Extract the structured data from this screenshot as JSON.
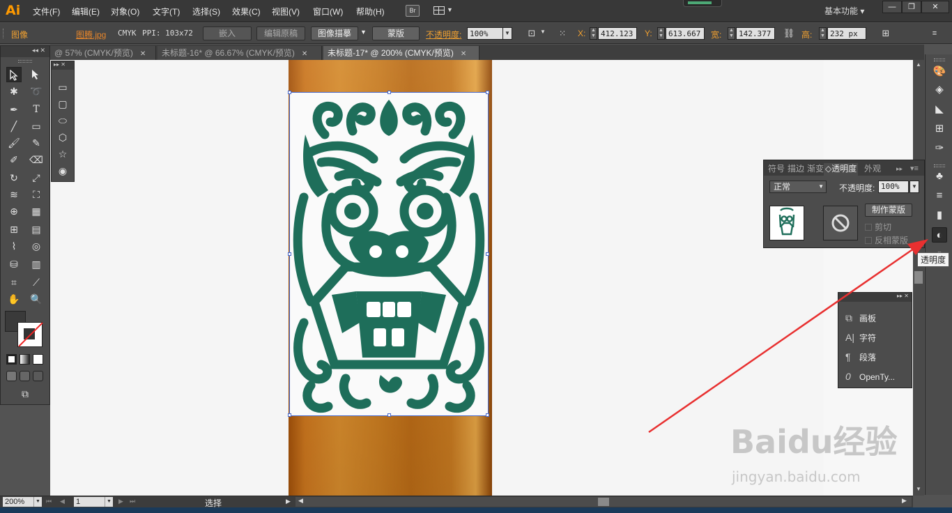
{
  "app": {
    "logo": "Ai",
    "menu": [
      "文件(F)",
      "编辑(E)",
      "对象(O)",
      "文字(T)",
      "选择(S)",
      "效果(C)",
      "视图(V)",
      "窗口(W)",
      "帮助(H)"
    ],
    "bridge_label": "Br",
    "workspace": "基本功能",
    "window_buttons": [
      "—",
      "❐",
      "✕"
    ]
  },
  "control": {
    "object_type": "图像",
    "file_name": "图腾.jpg",
    "color_mode": "CMYK",
    "ppi": "PPI: 103x72",
    "embed_btn": "嵌入",
    "edit_original_btn": "编辑原稿",
    "image_trace_btn": "图像描摹",
    "mask_btn": "蒙版",
    "opacity_label": "不透明度:",
    "opacity_value": "100%",
    "x_label": "X:",
    "x_value": "412.123",
    "y_label": "Y:",
    "y_value": "613.667",
    "w_label": "宽:",
    "w_value": "142.377",
    "h_label": "高:",
    "h_value": "232 px"
  },
  "tabs": [
    {
      "label": "@ 57% (CMYK/预览)"
    },
    {
      "label": "未标题-16* @ 66.67% (CMYK/预览)"
    },
    {
      "label": "未标题-17* @ 200% (CMYK/预览)"
    }
  ],
  "transparency": {
    "tabs": [
      "符号",
      "描边",
      "渐变",
      "透明度",
      "外观"
    ],
    "active_tab": "透明度",
    "blend_mode": "正常",
    "opacity_label": "不透明度:",
    "opacity_value": "100%",
    "make_mask_btn": "制作蒙版",
    "clip_label": "剪切",
    "invert_label": "反相蒙版"
  },
  "tooltip": "透明度",
  "float_panel": {
    "items": [
      {
        "label": "画板",
        "icon": "artboard-icon"
      },
      {
        "label": "字符",
        "icon": "character-icon"
      },
      {
        "label": "段落",
        "icon": "paragraph-icon"
      },
      {
        "label": "OpenTy...",
        "icon": "opentype-icon"
      }
    ]
  },
  "status": {
    "zoom": "200%",
    "page": "1",
    "tool": "选择"
  },
  "watermark": {
    "brand": "Baidu经验",
    "url": "jingyan.baidu.com"
  },
  "colors": {
    "accent": "#ff9a00",
    "totem_green": "#1e6e5a",
    "arrow_red": "#e83030",
    "selection_blue": "#4466cc"
  }
}
